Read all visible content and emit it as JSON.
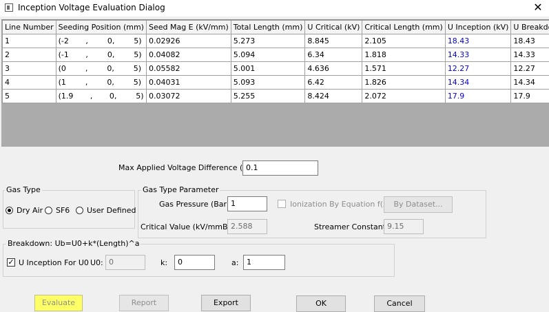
{
  "window": {
    "title": "Inception Voltage Evaluation Dialog",
    "close_glyph": "✕"
  },
  "grid": {
    "columns": [
      "Line Number",
      "Seeding Position (mm)",
      "Seed Mag E (kV/mm)",
      "Total Length (mm)",
      "U Critical (kV)",
      "Critical Length (mm)",
      "U Inception (kV)",
      "U Breakdown (kV)"
    ],
    "rows": [
      [
        "1",
        "(-2       ,        0,        5)",
        "0.02926",
        "5.273",
        "8.845",
        "2.105",
        "18.43",
        "18.43"
      ],
      [
        "2",
        "(-1       ,        0,        5)",
        "0.04082",
        "5.094",
        "6.34",
        "1.818",
        "14.33",
        "14.33"
      ],
      [
        "3",
        "(0        ,        0,        5)",
        "0.05582",
        "5.001",
        "4.636",
        "1.571",
        "12.27",
        "12.27"
      ],
      [
        "4",
        "(1        ,        0,        5)",
        "0.04031",
        "5.093",
        "6.42",
        "1.826",
        "14.34",
        "14.34"
      ],
      [
        "5",
        "(1.9       ,       0,        5)",
        "0.03072",
        "5.255",
        "8.424",
        "2.072",
        "17.9",
        "17.9"
      ]
    ]
  },
  "max_voltage": {
    "label": "Max Applied Voltage Difference (kV):",
    "value": "0.1"
  },
  "gas_type": {
    "title": "Gas Type",
    "options": [
      "Dry Air",
      "SF6",
      "User Defined"
    ],
    "selected": "Dry Air"
  },
  "gas_param": {
    "title": "Gas Type Parameter",
    "pressure_label": "Gas Pressure (Bar):",
    "pressure_value": "1",
    "ionization_label": "Ionization By Equation f(x):",
    "dataset_button": "By Dataset...",
    "critical_label": "Critical Value (kV/mmBar):",
    "critical_value": "2.588",
    "streamer_label": "Streamer Constant:",
    "streamer_value": "9.15"
  },
  "breakdown": {
    "title": "Breakdown: Ub=U0+k*(Length)^a",
    "use_inception_label": "U Inception For U0",
    "use_inception_checked": true,
    "u0_label": "U0:",
    "u0_value": "0",
    "k_label": "k:",
    "k_value": "0",
    "a_label": "a:",
    "a_value": "1"
  },
  "buttons": {
    "evaluate": "Evaluate",
    "report": "Report",
    "export": "Export",
    "ok": "OK",
    "cancel": "Cancel"
  },
  "colors": {
    "inception_text": "#0000e0",
    "evaluate_highlight": "#ffff66"
  }
}
